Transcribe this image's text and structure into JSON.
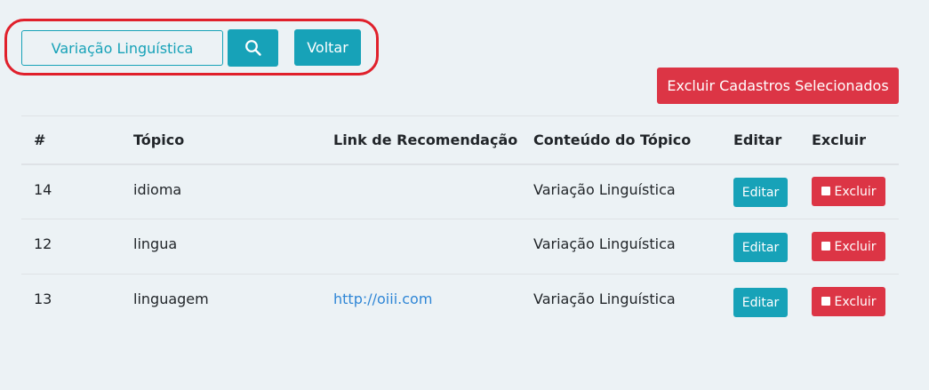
{
  "search": {
    "value": "Variação Linguística",
    "icon": "search-icon",
    "back_label": "Voltar"
  },
  "bulk_delete_label": "Excluir Cadastros Selecionados",
  "table": {
    "headers": [
      "#",
      "Tópico",
      "Link de Recomendação",
      "Conteúdo do Tópico",
      "Editar",
      "Excluir"
    ],
    "rows": [
      {
        "id": "14",
        "topic": "idioma",
        "link": "",
        "content": "Variação Linguística",
        "edit": "Editar",
        "delete": "Excluir"
      },
      {
        "id": "12",
        "topic": "lingua",
        "link": "",
        "content": "Variação Linguística",
        "edit": "Editar",
        "delete": "Excluir"
      },
      {
        "id": "13",
        "topic": "linguagem",
        "link": "http://oiii.com",
        "content": "Variação Linguística",
        "edit": "Editar",
        "delete": "Excluir"
      }
    ]
  },
  "colors": {
    "info": "#17a2b8",
    "danger": "#dc3545",
    "highlight": "#e0202b",
    "background": "#ecf2f5",
    "link": "#2f86d6"
  }
}
